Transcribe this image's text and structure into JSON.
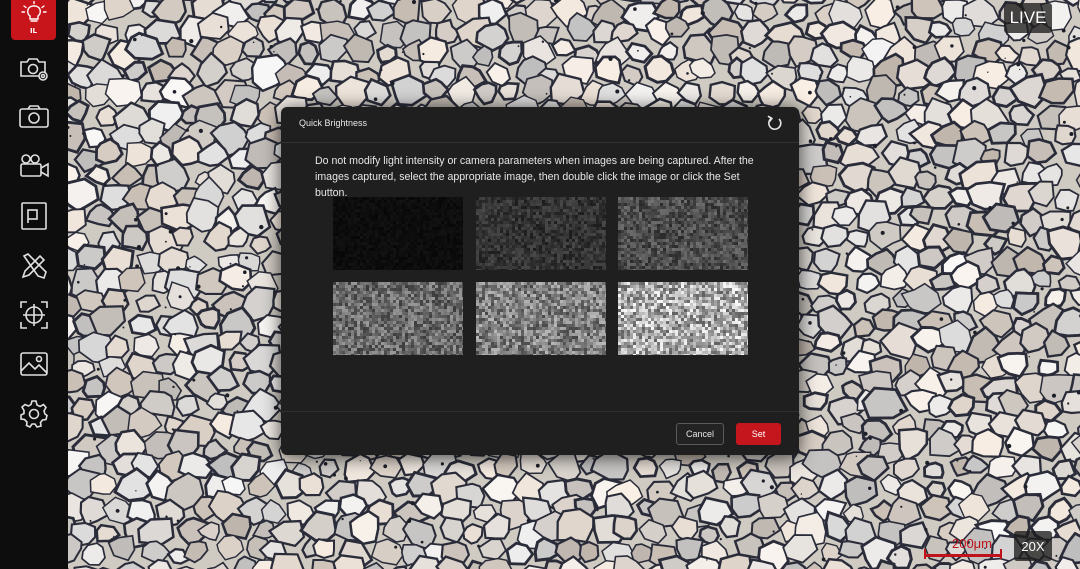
{
  "sidebar": {
    "illumination_label": "IL",
    "items": [
      {
        "icon": "camera-settings-icon"
      },
      {
        "icon": "camera-capture-icon"
      },
      {
        "icon": "video-record-icon"
      },
      {
        "icon": "presentation-icon"
      },
      {
        "icon": "measure-tools-icon"
      },
      {
        "icon": "crosshair-target-icon"
      },
      {
        "icon": "image-gallery-icon"
      },
      {
        "icon": "gear-icon"
      }
    ]
  },
  "overlay": {
    "live_label": "LIVE",
    "zoom_label": "20X",
    "scale_label": "200μm"
  },
  "dialog": {
    "title": "Quick Brightness",
    "message": "Do not modify light intensity or camera parameters when images are being captured. After the images captured, select the appropriate image, then double click the image or click the Set button.",
    "thumbnails": [
      {
        "brightness": 0.05,
        "selected": true
      },
      {
        "brightness": 0.2,
        "selected": false
      },
      {
        "brightness": 0.3,
        "selected": false
      },
      {
        "brightness": 0.42,
        "selected": false
      },
      {
        "brightness": 0.5,
        "selected": false
      },
      {
        "brightness": 0.68,
        "selected": false
      }
    ],
    "cancel_label": "Cancel",
    "set_label": "Set"
  },
  "colors": {
    "accent_red": "#c4161c",
    "selection_green": "#54b22e",
    "dialog_bg": "#1f1f1f"
  }
}
